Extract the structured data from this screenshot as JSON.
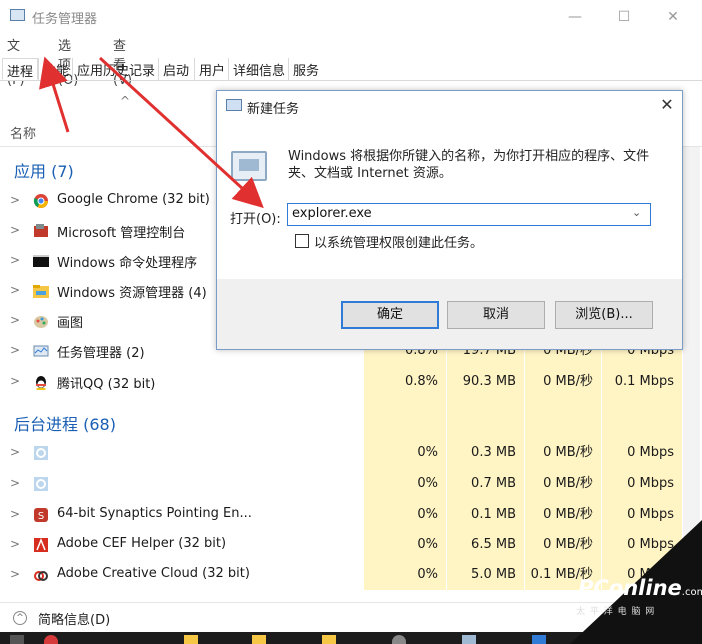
{
  "window": {
    "title": "任务管理器",
    "minimize": "—",
    "maximize": "☐",
    "close": "✕"
  },
  "menu": [
    "文件(F)",
    "选项(O)",
    "查看(V)"
  ],
  "tabs": [
    "进程",
    "性能",
    "应用历史记录",
    "启动",
    "用户",
    "详细信息",
    "服务"
  ],
  "column_name": "名称",
  "sort_indicator": "^",
  "sections": {
    "apps": "应用 (7)",
    "background": "后台进程 (68)"
  },
  "app_rows": [
    {
      "name": "Google Chrome (32 bit)",
      "icon": "chrome-icon"
    },
    {
      "name": "Microsoft 管理控制台",
      "icon": "mmc-icon"
    },
    {
      "name": "Windows 命令处理程序",
      "icon": "cmd-icon"
    },
    {
      "name": "Windows 资源管理器 (4)",
      "icon": "folder-icon"
    },
    {
      "name": "画图",
      "icon": "paint-icon"
    },
    {
      "name": "任务管理器 (2)",
      "icon": "taskmgr-icon",
      "cpu": "0.8%",
      "mem": "19.7 MB",
      "disk": "0 MB/秒",
      "net": "0 Mbps"
    },
    {
      "name": "腾讯QQ (32 bit)",
      "icon": "qq-icon",
      "cpu": "0.8%",
      "mem": "90.3 MB",
      "disk": "0 MB/秒",
      "net": "0.1 Mbps"
    }
  ],
  "bg_rows": [
    {
      "name": "",
      "icon": "gear-icon",
      "cpu": "0%",
      "mem": "0.3 MB",
      "disk": "0 MB/秒",
      "net": "0 Mbps"
    },
    {
      "name": "",
      "icon": "gear-icon",
      "cpu": "0%",
      "mem": "0.7 MB",
      "disk": "0 MB/秒",
      "net": "0 Mbps"
    },
    {
      "name": "64-bit Synaptics Pointing En...",
      "icon": "synaptics-icon",
      "cpu": "0%",
      "mem": "0.1 MB",
      "disk": "0 MB/秒",
      "net": "0 Mbps"
    },
    {
      "name": "Adobe CEF Helper (32 bit)",
      "icon": "adobe-icon",
      "cpu": "0%",
      "mem": "6.5 MB",
      "disk": "0 MB/秒",
      "net": "0 Mbps"
    },
    {
      "name": "Adobe Creative Cloud (32 bit)",
      "icon": "creative-cloud-icon",
      "cpu": "0%",
      "mem": "5.0 MB",
      "disk": "0.1 MB/秒",
      "net": "0 Mbps"
    }
  ],
  "footer": {
    "label": "简略信息(D)"
  },
  "dialog": {
    "title": "新建任务",
    "close": "✕",
    "desc_line1": "Windows 将根据你所键入的名称，为你打开相应的程序、文件",
    "desc_line2": "夹、文档或 Internet 资源。",
    "open_label": "打开(O):",
    "open_value": "explorer.exe",
    "admin_label": "以系统管理权限创建此任务。",
    "ok": "确定",
    "cancel": "取消",
    "browse": "浏览(B)..."
  },
  "watermark": {
    "brand": "PConline",
    "suffix": ".com.cn",
    "sub": "太 平 洋 电 脑 网"
  },
  "colors": {
    "accent": "#2f7bd6",
    "section": "#1a5fb4",
    "heat": "#fff4c4",
    "arrow": "#e03030"
  }
}
